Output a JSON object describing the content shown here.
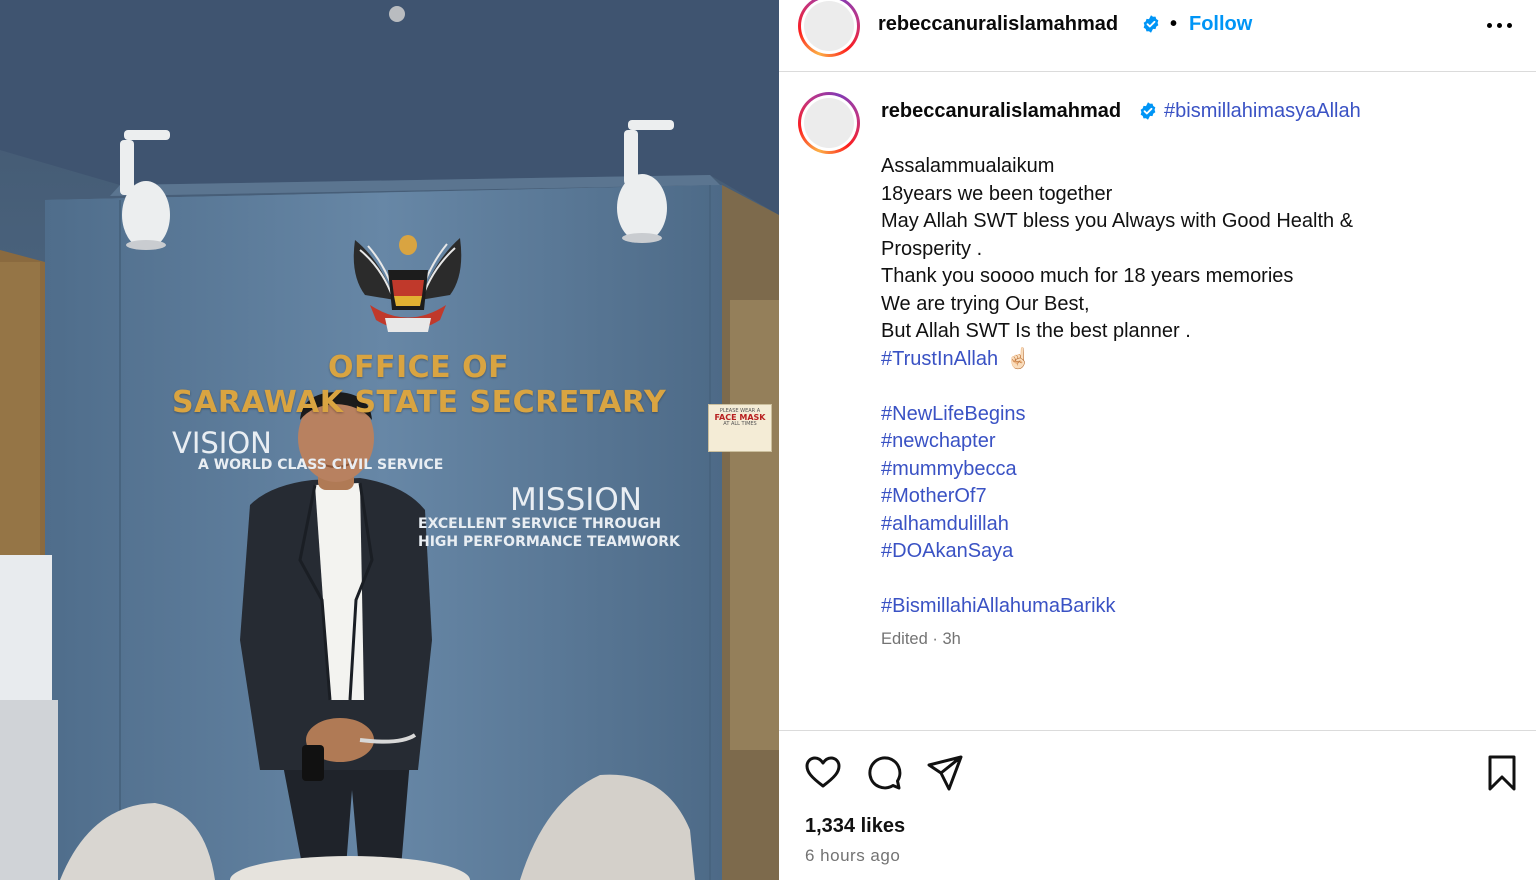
{
  "photo": {
    "sign_line1": "OFFICE OF",
    "sign_line2": "SARAWAK STATE SECRETARY",
    "vision_title": "VISION",
    "vision_text": "A WORLD CLASS CIVIL SERVICE",
    "mission_title": "MISSION",
    "mission_text1": "EXCELLENT SERVICE THROUGH",
    "mission_text2": "HIGH PERFORMANCE TEAMWORK",
    "mask_sign_1": "PLEASE WEAR A",
    "mask_sign_2": "FACE MASK",
    "mask_sign_3": "AT ALL TIMES"
  },
  "header": {
    "username": "rebeccanuralislamahmad",
    "separator": "•",
    "follow_label": "Follow",
    "more_icon": "more-horizontal-icon"
  },
  "caption": {
    "username": "rebeccanuralislamahmad",
    "first_hashtag": "#bismillahimasyaAllah",
    "lines": [
      {
        "text": "Assalammualaikum",
        "tag": false
      },
      {
        "text": "18years we been together",
        "tag": false
      },
      {
        "text": "May Allah SWT bless you Always with Good Health &",
        "tag": false
      },
      {
        "text": "Prosperity .",
        "tag": false
      },
      {
        "text": "Thank you soooo much for 18 years memories",
        "tag": false
      },
      {
        "text": "We are trying Our Best,",
        "tag": false
      },
      {
        "text": "But Allah SWT Is the best planner .",
        "tag": false
      },
      {
        "text": "#TrustInAllah",
        "tag": true,
        "emoji": "☝🏻"
      },
      {
        "text": "",
        "tag": false
      },
      {
        "text": "#NewLifeBegins",
        "tag": true
      },
      {
        "text": "#newchapter",
        "tag": true
      },
      {
        "text": "#mummybecca",
        "tag": true
      },
      {
        "text": "#MotherOf7",
        "tag": true
      },
      {
        "text": "#alhamdulillah",
        "tag": true
      },
      {
        "text": "#DOAkanSaya",
        "tag": true
      },
      {
        "text": "",
        "tag": false
      },
      {
        "text": "#BismillahiAllahumaBarikk",
        "tag": true
      }
    ],
    "meta": "Edited · 3h"
  },
  "actions": {
    "icons": [
      "heart-icon",
      "comment-icon",
      "share-icon",
      "bookmark-icon"
    ],
    "likes": "1,334 likes",
    "time": "6 hours ago"
  },
  "colors": {
    "link": "#3a52c4",
    "follow": "#0095f6",
    "muted": "#737373",
    "verified": "#0095f6",
    "sign_gold": "#d9a441"
  }
}
